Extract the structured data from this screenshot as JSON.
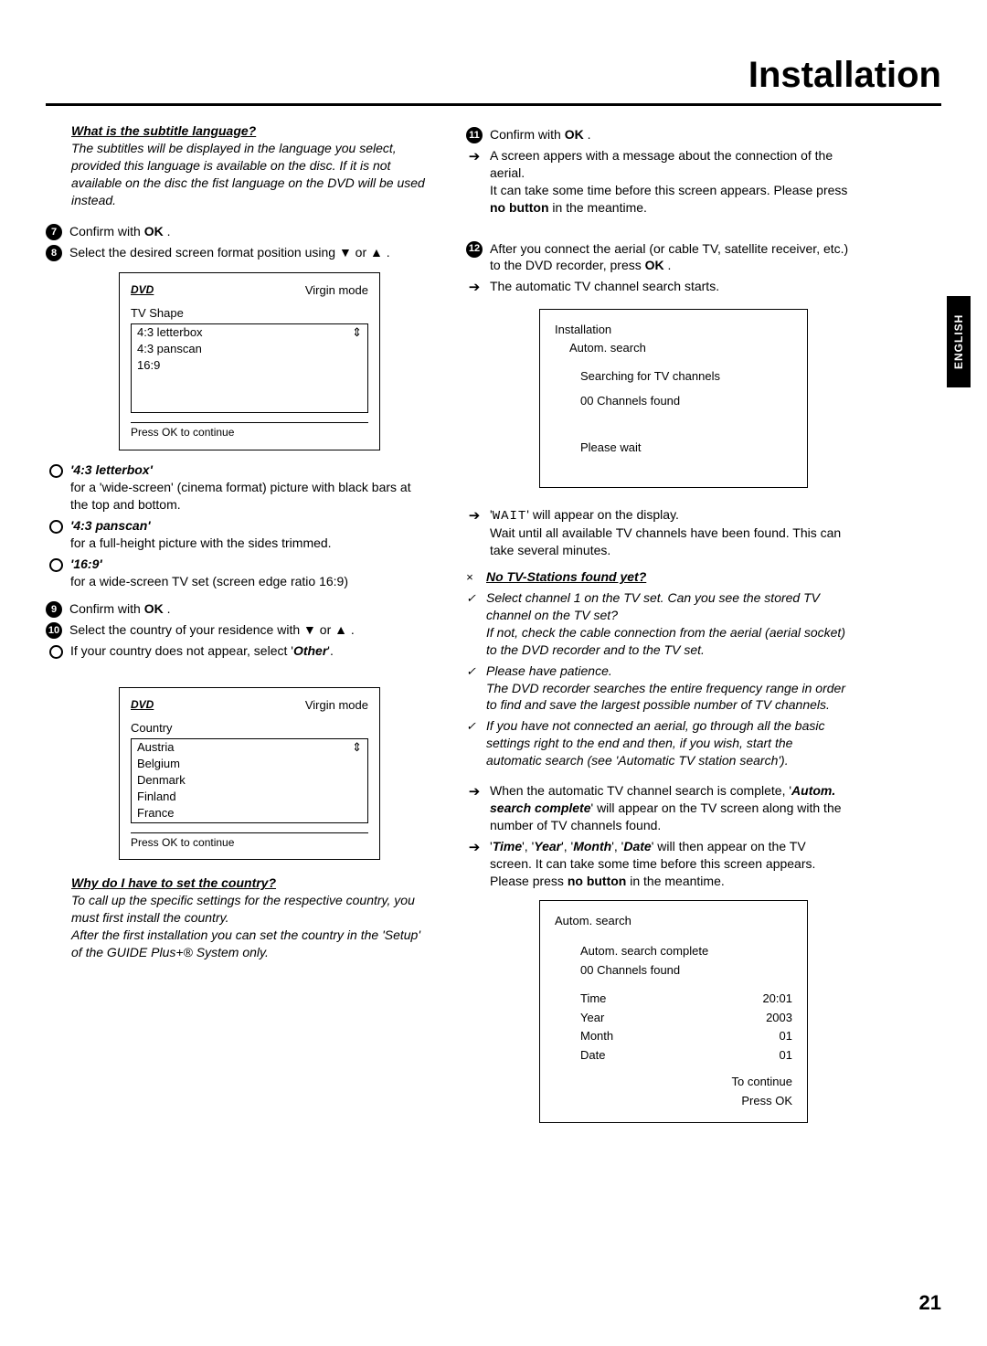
{
  "page": {
    "title": "Installation",
    "number": "21",
    "side_tab": "ENGLISH"
  },
  "left": {
    "note1_title": "What is the subtitle language?",
    "note1_body": "The subtitles will be displayed in the language you select, provided this language is available on the disc. If it is not available on the disc the fist language on the DVD will be used instead.",
    "step7": "Confirm with ",
    "ok": "OK",
    "step8_a": "Select the desired screen format position using ",
    "step8_b": " or ",
    "screen1": {
      "logo": "DVD",
      "mode": "Virgin mode",
      "section": "TV Shape",
      "opt1": "4:3 letterbox",
      "opt2": "4:3 panscan",
      "opt3": "16:9",
      "foot": "Press OK to continue",
      "updown": "⇕"
    },
    "opt_lb_title": "'4:3 letterbox'",
    "opt_lb_desc": "for a 'wide-screen' (cinema format) picture with black bars at the top and bottom.",
    "opt_ps_title": "'4:3 panscan'",
    "opt_ps_desc": "for a full-height picture with the sides trimmed.",
    "opt_169_title": "'16:9'",
    "opt_169_desc": "for a wide-screen TV set (screen edge ratio 16:9)",
    "step9": "Confirm with ",
    "step10_a": "Select the country of your residence with ",
    "step10_b": " or ",
    "step10_sub": "If your country does not appear, select '",
    "other": "Other",
    "screen2": {
      "logo": "DVD",
      "mode": "Virgin mode",
      "section": "Country",
      "opt1": "Austria",
      "opt2": "Belgium",
      "opt3": "Denmark",
      "opt4": "Finland",
      "opt5": "France",
      "foot": "Press OK to continue",
      "updown": "⇕"
    },
    "note2_title": "Why do I have to set the country?",
    "note2_body1": "To call up the specific settings for the respective country, you must first install the country.",
    "note2_body2": "After the first installation you can set the country in the 'Setup' of the GUIDE Plus+® System only."
  },
  "right": {
    "step11": "Confirm with ",
    "step11_sub1": "A screen appers with a message about the connection of the aerial.",
    "step11_sub2a": "It can take some time before this screen appears. Please press ",
    "no_button": "no button",
    "step11_sub2b": " in the meantime.",
    "step12_a": "After you connect the aerial (or cable TV, satellite receiver, etc.) to the DVD recorder, press ",
    "step12_sub": "The automatic TV channel search starts.",
    "screen3": {
      "l1": "Installation",
      "l2": "Autom. search",
      "l3": "Searching for TV channels",
      "l4": "00 Channels found",
      "l5": "Please wait"
    },
    "wait_a": "'",
    "wait_seg": "WAIT",
    "wait_b": "' will appear on the display.",
    "wait_c": "Wait until all available TV channels have been found. This can take several minutes.",
    "trouble_title": "No TV-Stations found yet?",
    "trouble_x": "×",
    "t1": "Select channel 1 on the TV set. Can you see the stored TV channel on the TV set?",
    "t1b": "If not, check the cable connection from the aerial (aerial socket) to the DVD recorder and to the TV set.",
    "t2": "Please have patience.",
    "t2b": "The DVD recorder searches the entire frequency range in order to find and save the largest possible number of TV channels.",
    "t3": "If you have not connected an aerial, go through all the basic settings right to the end and then, if you wish, start the automatic search (see 'Automatic TV station search').",
    "complete_a": "When the automatic TV channel search is complete, '",
    "complete_b": "Autom. search complete",
    "complete_c": "' will appear on the TV screen along with the number of TV channels found.",
    "time_a": "'",
    "time": "Time",
    "year": "Year",
    "month": "Month",
    "date": "Date",
    "time_b": "' will then appear on the TV screen. It can take some time before this screen appears. Please press ",
    "time_c": " in the meantime.",
    "screen4": {
      "l1": "Autom. search",
      "l2": "Autom. search complete",
      "l3": "00 Channels found",
      "r_time_l": "Time",
      "r_time_v": "20:01",
      "r_year_l": "Year",
      "r_year_v": "2003",
      "r_month_l": "Month",
      "r_month_v": "01",
      "r_date_l": "Date",
      "r_date_v": "01",
      "foot1": "To continue",
      "foot2": "Press OK"
    }
  }
}
